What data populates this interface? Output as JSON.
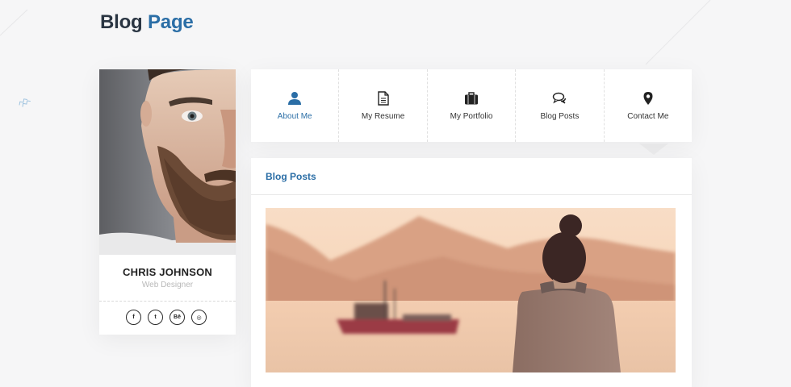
{
  "page": {
    "title_word1": "Blog",
    "title_word2": "Page"
  },
  "profile": {
    "name": "CHRIS JOHNSON",
    "role": "Web Designer",
    "social": [
      {
        "label": "f",
        "icon": "facebook-icon"
      },
      {
        "label": "t",
        "icon": "twitter-icon"
      },
      {
        "label": "Bē",
        "icon": "behance-icon"
      },
      {
        "label": "◎",
        "icon": "dribbble-icon"
      }
    ]
  },
  "nav": {
    "items": [
      {
        "label": "About Me",
        "icon": "user-icon",
        "active": true
      },
      {
        "label": "My Resume",
        "icon": "document-icon",
        "active": false
      },
      {
        "label": "My Portfolio",
        "icon": "briefcase-icon",
        "active": false
      },
      {
        "label": "Blog Posts",
        "icon": "chat-bubbles-icon",
        "active": false
      },
      {
        "label": "Contact Me",
        "icon": "location-pin-icon",
        "active": false
      }
    ]
  },
  "blog": {
    "section_title": "Blog Posts"
  },
  "colors": {
    "accent": "#2b6ea6",
    "title_dark": "#2a3542",
    "background": "#f6f6f7"
  }
}
